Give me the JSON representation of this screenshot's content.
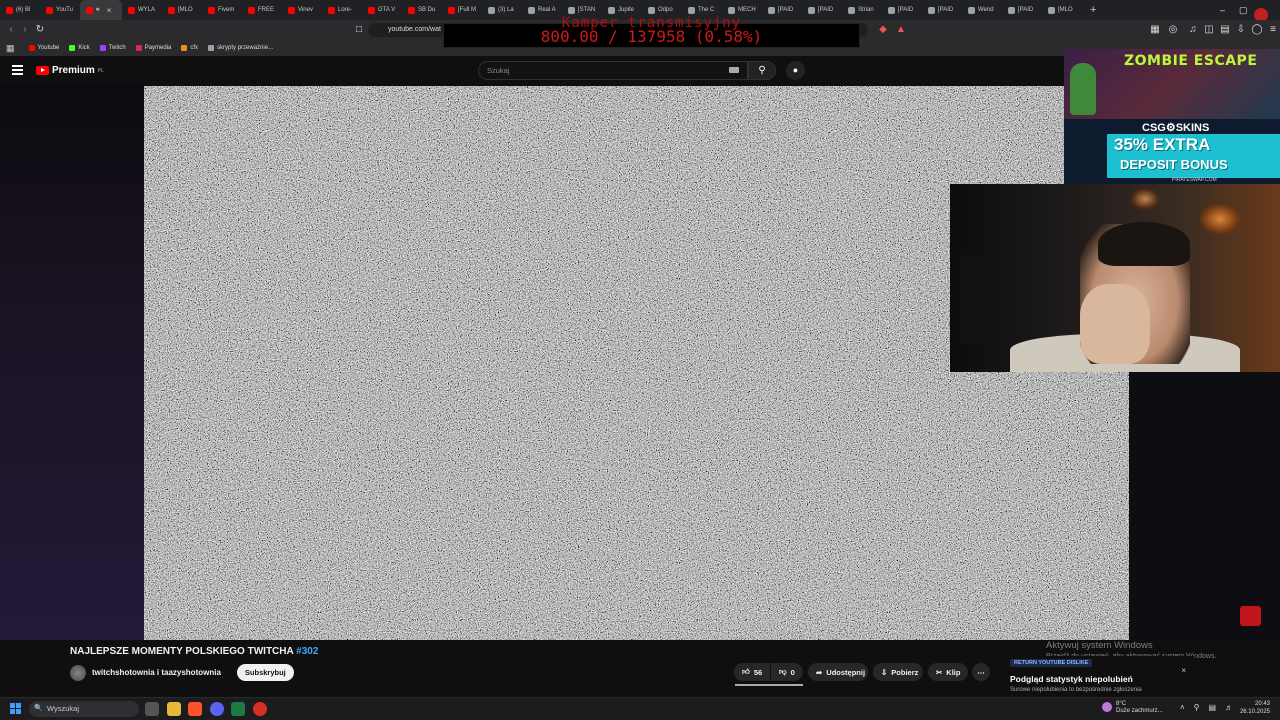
{
  "browser": {
    "tabs": [
      {
        "label": "(6) Bl",
        "favicon": "youtube-icon"
      },
      {
        "label": "YouTu",
        "favicon": "youtube-icon"
      },
      {
        "label": "",
        "favicon": "youtube-icon",
        "active": true
      },
      {
        "label": "WYLA",
        "favicon": "youtube-icon"
      },
      {
        "label": "[MLO",
        "favicon": "youtube-icon"
      },
      {
        "label": "Fivem",
        "favicon": "youtube-icon"
      },
      {
        "label": "FREE",
        "favicon": "youtube-icon"
      },
      {
        "label": "Vinev",
        "favicon": "youtube-icon"
      },
      {
        "label": "Lore-",
        "favicon": "youtube-icon"
      },
      {
        "label": "GTA V",
        "favicon": "youtube-icon"
      },
      {
        "label": "SB Du",
        "favicon": "youtube-icon"
      },
      {
        "label": "[Full M",
        "favicon": "youtube-icon"
      },
      {
        "label": "(3) La",
        "favicon": "generic-icon"
      },
      {
        "label": "Real A",
        "favicon": "generic-icon"
      },
      {
        "label": "[STAN",
        "favicon": "generic-icon"
      },
      {
        "label": "Jupite",
        "favicon": "generic-icon"
      },
      {
        "label": "Odpo",
        "favicon": "generic-icon"
      },
      {
        "label": "The C",
        "favicon": "generic-icon"
      },
      {
        "label": "MECH",
        "favicon": "generic-icon"
      },
      {
        "label": "[PAID",
        "favicon": "generic-icon"
      },
      {
        "label": "[PAID",
        "favicon": "generic-icon"
      },
      {
        "label": "Strian",
        "favicon": "generic-icon"
      },
      {
        "label": "[PAID",
        "favicon": "generic-icon"
      },
      {
        "label": "[PAID",
        "favicon": "generic-icon"
      },
      {
        "label": "Wend",
        "favicon": "generic-icon"
      },
      {
        "label": "[PAID",
        "favicon": "generic-icon"
      },
      {
        "label": "[MLO",
        "favicon": "generic-icon"
      }
    ],
    "new_tab": "+",
    "url": "youtube.com/wat",
    "bookmarks": [
      {
        "label": "Youtube",
        "color": "#ff0000"
      },
      {
        "label": "Kick",
        "color": "#53fc18"
      },
      {
        "label": "Twitch",
        "color": "#9146ff"
      },
      {
        "label": "Paymedia",
        "color": "#e0245e"
      },
      {
        "label": "cfx",
        "color": "#f08a24"
      },
      {
        "label": "skrypty przeważnie...",
        "color": "#9aa0a6"
      }
    ]
  },
  "overlay_counter": {
    "caption": "Kamper transmisyjny",
    "value": "800.00 / 137958 (0.58%)"
  },
  "youtube": {
    "logo_text": "Premium",
    "logo_region": "PL",
    "search_placeholder": "Szukaj"
  },
  "ad": {
    "headline": "ZOMBIE ESCAPE",
    "brand": "CSG⚙SKINS",
    "offer_line1": "35% EXTRA",
    "offer_line2": "DEPOSIT BONUS",
    "site": "PIRATESWAP.COM"
  },
  "video": {
    "title": "NAJLEPSZE MOMENTY POLSKIEGO TWITCHA",
    "title_tag": "#302",
    "channel": "twitchshotownia i taazyshotownia",
    "subscribe_label": "Subskrybuj",
    "likes": "56",
    "dislikes": "0",
    "share_label": "Udostępnij",
    "download_label": "Pobierz",
    "clip_label": "Klip",
    "more_label": "⋯"
  },
  "ryd_panel": {
    "badge": "RETURN YOUTUBE DISLIKE",
    "heading": "Podgląd statystyk niepolubień",
    "subtext": "Surowe niepolubienia to bezpośrednie zgłoszenia",
    "close": "×"
  },
  "windows_watermark": {
    "line1": "Aktywuj system Windows",
    "line2": "Przejdź do ustawień, aby aktywować system Windows."
  },
  "taskbar": {
    "search_placeholder": "Wyszukaj",
    "weather_temp": "8°C",
    "weather_desc": "Duże zachmurz...",
    "time": "20:43",
    "date": "26.10.2025"
  }
}
